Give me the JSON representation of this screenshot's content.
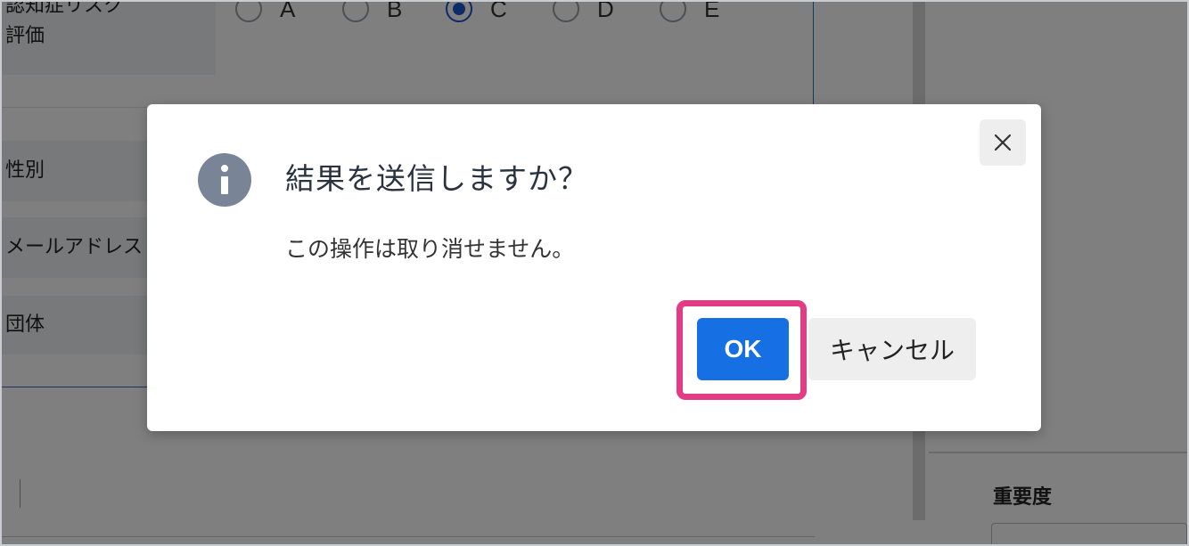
{
  "background": {
    "risk_label_line1": "認知症リスク",
    "risk_label_line2": "評価",
    "radio_options": [
      "A",
      "B",
      "C",
      "D",
      "E"
    ],
    "radio_selected": "C",
    "gender_label": "性別",
    "email_label": "メールアドレス",
    "group_label": "団体",
    "importance_label": "重要度"
  },
  "dialog": {
    "title": "結果を送信しますか？",
    "message": "この操作は取り消せません。",
    "ok_label": "OK",
    "cancel_label": "キャンセル",
    "icon": "info-icon",
    "close_icon": "close-icon"
  },
  "colors": {
    "ok_button": "#1670e4",
    "highlight": "#e23c84",
    "info_icon": "#798596",
    "overlay": "rgba(0,0,0,0.5)"
  }
}
